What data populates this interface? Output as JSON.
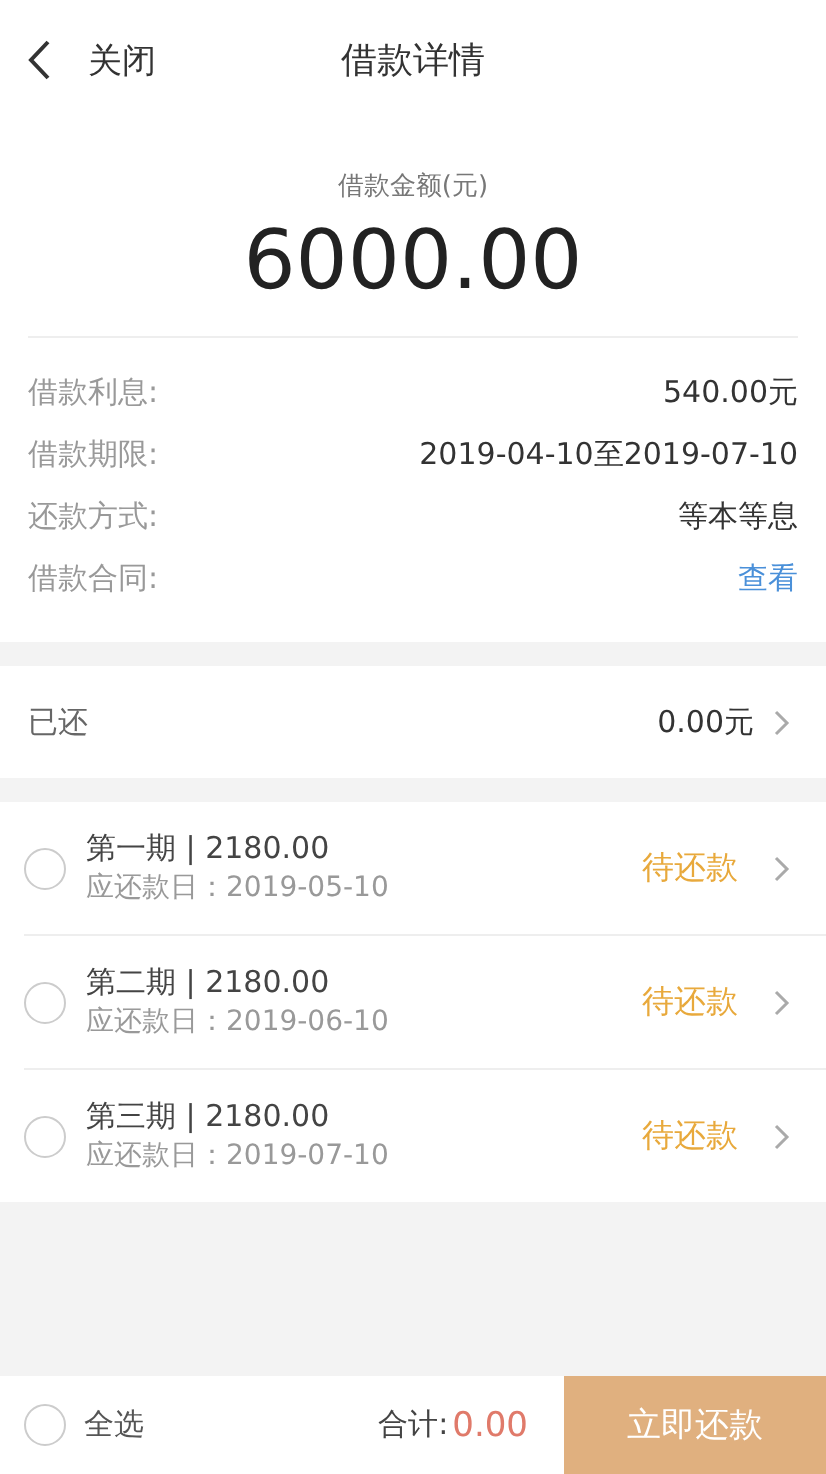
{
  "header": {
    "back_label": "关闭",
    "title": "借款详情"
  },
  "summary": {
    "amount_label": "借款金额(元)",
    "amount": "6000.00"
  },
  "details": [
    {
      "label": "借款利息:",
      "value": "540.00元",
      "kind": "text"
    },
    {
      "label": "借款期限:",
      "value": "2019-04-10至2019-07-10",
      "kind": "text"
    },
    {
      "label": "还款方式:",
      "value": "等本等息",
      "kind": "text"
    },
    {
      "label": "借款合同:",
      "value": "查看",
      "kind": "link"
    }
  ],
  "repaid": {
    "label": "已还",
    "value": "0.00元"
  },
  "installments": [
    {
      "title": "第一期 | 2180.00",
      "due": "应还款日：2019-05-10",
      "status": "待还款",
      "selected": false
    },
    {
      "title": "第二期 | 2180.00",
      "due": "应还款日：2019-06-10",
      "status": "待还款",
      "selected": false
    },
    {
      "title": "第三期 | 2180.00",
      "due": "应还款日：2019-07-10",
      "status": "待还款",
      "selected": false
    }
  ],
  "footer": {
    "select_all": {
      "label": "全选",
      "checked": false
    },
    "total_label": "合计:",
    "total": "0.00",
    "button": "立即还款"
  }
}
